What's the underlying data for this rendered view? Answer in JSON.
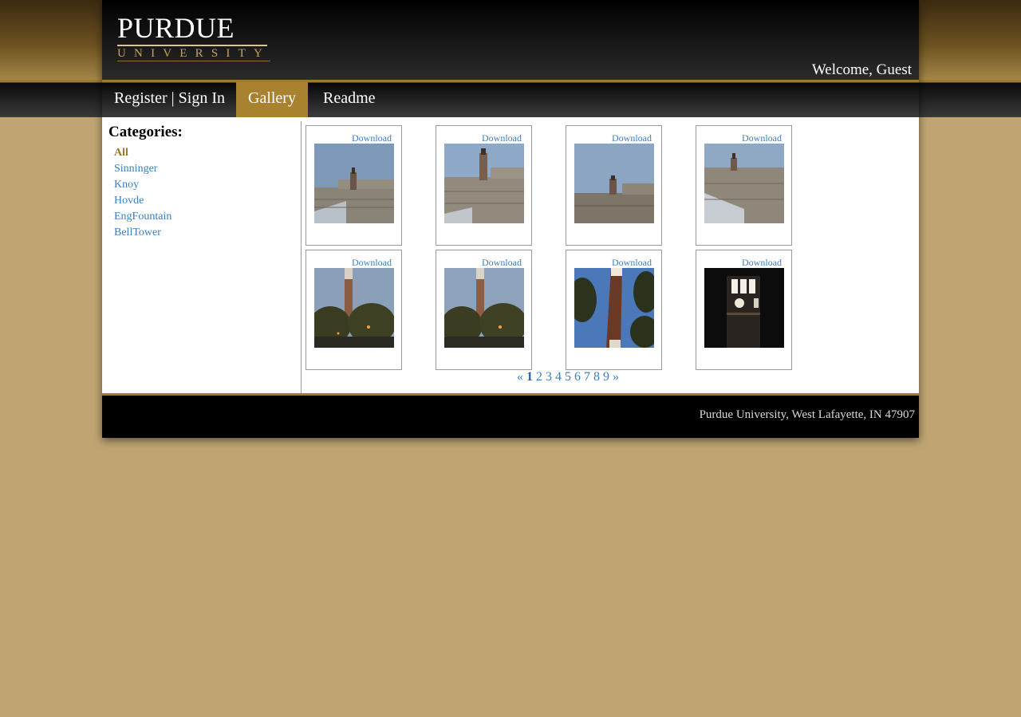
{
  "header": {
    "logo_main": "PURDUE",
    "logo_sub": "UNIVERSITY",
    "welcome": "Welcome, Guest"
  },
  "nav": {
    "items": [
      {
        "label": "Register | Sign In"
      },
      {
        "label": "Gallery"
      },
      {
        "label": "Readme"
      }
    ]
  },
  "sidebar": {
    "title": "Categories:",
    "items": [
      {
        "label": "All"
      },
      {
        "label": "Sinninger"
      },
      {
        "label": "Knoy"
      },
      {
        "label": "Hovde"
      },
      {
        "label": "EngFountain"
      },
      {
        "label": "BellTower"
      }
    ]
  },
  "gallery": {
    "download_label": "Download"
  },
  "pagination": {
    "prev": "«",
    "pages": [
      "1",
      "2",
      "3",
      "4",
      "5",
      "6",
      "7",
      "8",
      "9"
    ],
    "next": "»"
  },
  "footer": {
    "text": "Purdue University, West Lafayette, IN 47907"
  },
  "colors": {
    "page_bg": "#c0a572",
    "gold": "#a07a32",
    "link": "#3d7fc1",
    "active_category": "#9a7728"
  }
}
